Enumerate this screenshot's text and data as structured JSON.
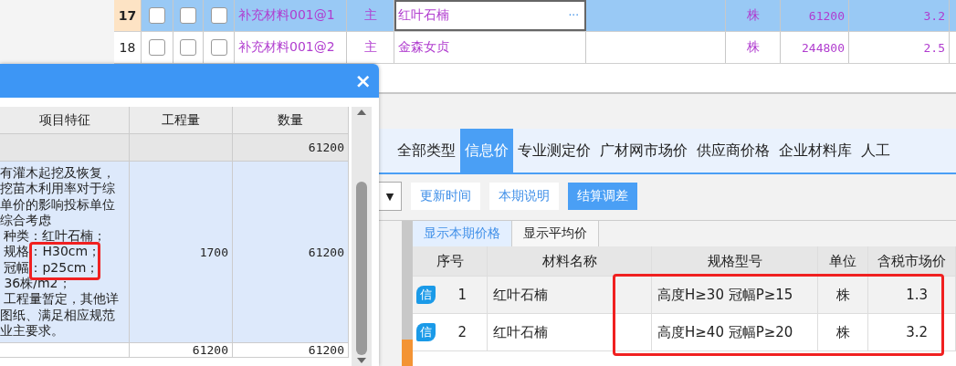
{
  "main_grid": {
    "rows": [
      {
        "number": "17",
        "selected": true,
        "checks": [
          false,
          false,
          false
        ],
        "code": "补充材料001@1",
        "type": "主",
        "name": "红叶石楠",
        "editing": true,
        "editor_button": "···",
        "unit": "株",
        "quantity": "61200",
        "price": "3.2"
      },
      {
        "number": "18",
        "selected": false,
        "checks": [
          false,
          false,
          false
        ],
        "code": "补充材料001@2",
        "type": "主",
        "name": "金森女贞",
        "editing": false,
        "unit": "株",
        "quantity": "244800",
        "price": "2.5"
      }
    ]
  },
  "dialog": {
    "close": "×",
    "columns": [
      "项目特征",
      "工程量",
      "数量"
    ],
    "rows": [
      {
        "kind": "group",
        "feature": "",
        "engineering_quantity": "",
        "quantity": "61200"
      },
      {
        "kind": "item",
        "feature_lines": [
          "有灌木起挖及恢复，",
          "挖苗木利用率对于综",
          "单价的影响投标单位",
          "综合考虑",
          " 种类：红叶石楠；",
          " 规格：H30cm；",
          " 冠幅：p25cm；",
          " 36株/m2；",
          " 工程量暂定，其他详",
          "图纸、满足相应规范",
          "业主要求。"
        ],
        "highlighted": true,
        "engineering_quantity": "1700",
        "quantity": "61200"
      },
      {
        "kind": "total",
        "feature": "",
        "engineering_quantity": "61200",
        "quantity": "61200"
      }
    ]
  },
  "price_panel": {
    "tabs": [
      {
        "label": "全部类型",
        "selected": false
      },
      {
        "label": "信息价",
        "selected": true
      },
      {
        "label": "专业测定价",
        "selected": false
      },
      {
        "label": "广材网市场价",
        "selected": false
      },
      {
        "label": "供应商价格",
        "selected": false
      },
      {
        "label": "企业材料库",
        "selected": false
      },
      {
        "label": "人工",
        "selected": false
      }
    ],
    "dropdown_arrow": "▼",
    "buttons": [
      {
        "label": "更新时间",
        "active": false
      },
      {
        "label": "本期说明",
        "active": false
      },
      {
        "label": "结算调差",
        "active": true
      }
    ],
    "subtabs": [
      {
        "label": "显示本期价格",
        "selected": true
      },
      {
        "label": "显示平均价",
        "selected": false
      }
    ],
    "table": {
      "highlighted": true,
      "columns": [
        "序号",
        "材料名称",
        "规格型号",
        "单位",
        "含税市场价"
      ],
      "rows": [
        {
          "badge": "信",
          "index": "1",
          "name": "红叶石楠",
          "spec": "高度H≥30 冠幅P≥15",
          "unit": "株",
          "price": "1.3"
        },
        {
          "badge": "信",
          "index": "2",
          "name": "红叶石楠",
          "spec": "高度H≥40 冠幅P≥20",
          "unit": "株",
          "price": "3.2"
        }
      ]
    }
  }
}
